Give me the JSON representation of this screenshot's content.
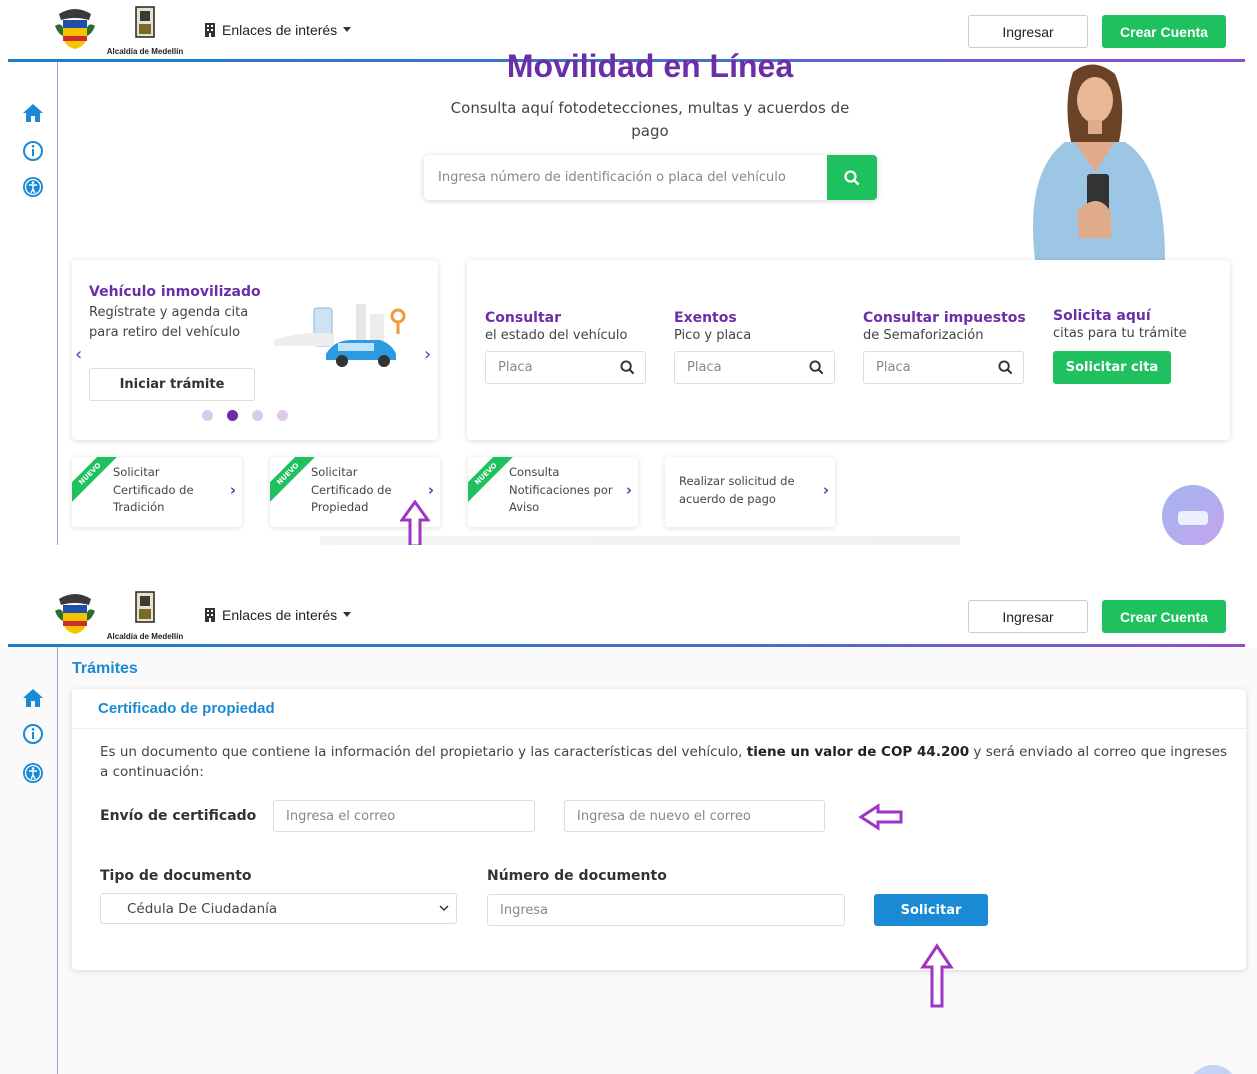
{
  "header": {
    "logo_text": "Alcaldía de Medellín",
    "links_label": "Enlaces de interés",
    "login_label": "Ingresar",
    "signup_label": "Crear Cuenta"
  },
  "icons": [
    "home-icon",
    "info-icon",
    "accessibility-icon",
    "search-icon",
    "chevron-down-icon",
    "building-icon",
    "chevron-right-icon",
    "chevron-left-icon",
    "arrow-up-icon",
    "arrow-left-icon"
  ],
  "colors": {
    "purple": "#6a2fa8",
    "green": "#1ec15e",
    "blue": "#1a8ad4"
  },
  "hero": {
    "title": "Movilidad en Línea",
    "subtitle": "Consulta aquí fotodetecciones, multas y acuerdos de pago",
    "search_placeholder": "Ingresa número de identificación o placa del vehículo"
  },
  "carousel": {
    "title": "Vehículo inmovilizado",
    "desc": "Regístrate y agenda cita para retiro del vehículo",
    "button": "Iniciar trámite",
    "slides": 4,
    "active_slide": 2
  },
  "quick": [
    {
      "title": "Consultar",
      "sub": "el estado del vehículo",
      "placeholder": "Placa"
    },
    {
      "title": "Exentos",
      "sub": "Pico y placa",
      "placeholder": "Placa"
    },
    {
      "title": "Consultar impuestos",
      "sub": "de Semaforización",
      "placeholder": "Placa"
    },
    {
      "title": "Solicita aquí",
      "sub": "citas para tu trámite",
      "button": "Solicitar cita"
    }
  ],
  "tiles": [
    {
      "badge": "NUEVO",
      "text": "Solicitar Certificado de Tradición"
    },
    {
      "badge": "NUEVO",
      "text": "Solicitar Certificado de Propiedad"
    },
    {
      "badge": "NUEVO",
      "text": "Consulta Notificaciones por Aviso"
    },
    {
      "text": "Realizar solicitud de acuerdo de pago"
    }
  ],
  "form": {
    "section": "Trámites",
    "title": "Certificado de propiedad",
    "desc_pre": "Es un documento que contiene la información del propietario y las características del vehículo, ",
    "desc_bold": "tiene un valor de COP 44.200",
    "desc_post": " y será enviado al correo que ingreses a continuación:",
    "send_label": "Envío de certificado",
    "email_placeholder": "Ingresa el correo",
    "email_confirm_placeholder": "Ingresa de nuevo el correo",
    "doc_type_label": "Tipo de documento",
    "doc_type_value": "Cédula De Ciudadanía",
    "doc_number_label": "Número de documento",
    "doc_number_placeholder": "Ingresa",
    "submit_label": "Solicitar"
  }
}
